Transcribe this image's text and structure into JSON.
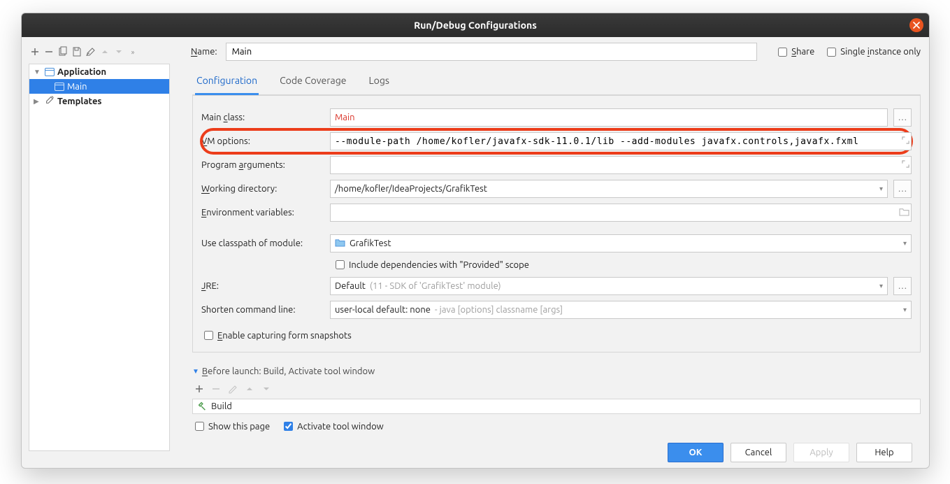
{
  "title": "Run/Debug Configurations",
  "toolbar": {
    "name_label": "Name:",
    "name_value": "Main",
    "share_label": "Share",
    "single_instance_label": "Single instance only"
  },
  "tree": {
    "application": "Application",
    "main": "Main",
    "templates": "Templates"
  },
  "tabs": {
    "configuration": "Configuration",
    "code_coverage": "Code Coverage",
    "logs": "Logs"
  },
  "form": {
    "main_class_label": "Main class:",
    "main_class_value": "Main",
    "vm_options_label": "VM options:",
    "vm_options_value": "--module-path /home/kofler/javafx-sdk-11.0.1/lib --add-modules javafx.controls,javafx.fxml",
    "program_args_label": "Program arguments:",
    "program_args_value": "",
    "workdir_label": "Working directory:",
    "workdir_value": "/home/kofler/IdeaProjects/GrafikTest",
    "env_label": "Environment variables:",
    "env_value": "",
    "classpath_label": "Use classpath of module:",
    "classpath_value": "GrafikTest",
    "include_provided_label": "Include dependencies with \"Provided\" scope",
    "jre_label": "JRE:",
    "jre_value": "Default ",
    "jre_hint": "(11 - SDK of 'GrafikTest' module)",
    "shorten_label": "Shorten command line:",
    "shorten_value": "user-local default: none ",
    "shorten_hint": "- java [options] classname [args]",
    "snapshots_label": "Enable capturing form snapshots"
  },
  "before_launch": {
    "header": "Before launch: Build, Activate tool window",
    "item": "Build",
    "show_page": "Show this page",
    "activate_tw": "Activate tool window"
  },
  "buttons": {
    "ok": "OK",
    "cancel": "Cancel",
    "apply": "Apply",
    "help": "Help"
  },
  "colors": {
    "highlight_ring": "#ec3d1b",
    "selection": "#2f80e7",
    "error_text": "#d93025"
  }
}
